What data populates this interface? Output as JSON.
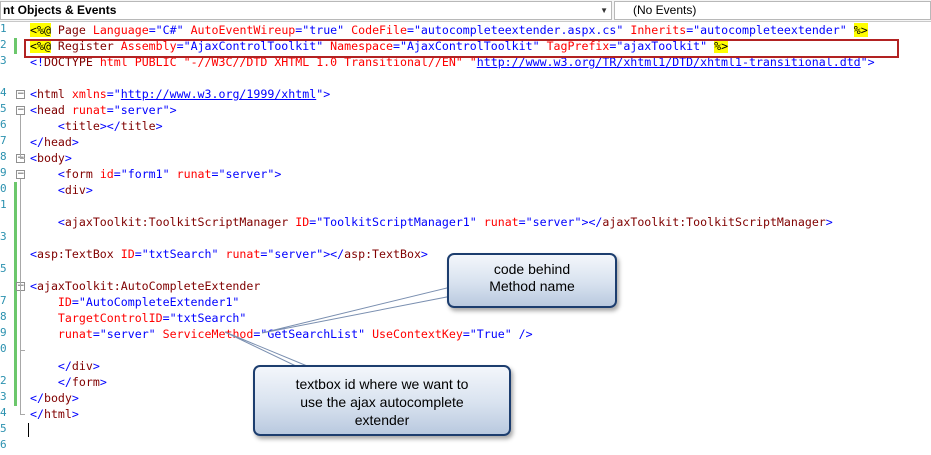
{
  "toolbar": {
    "objects_combo": "nt Objects & Events",
    "events_combo": "(No Events)"
  },
  "line_numbers": [
    "1",
    "2",
    "3",
    "",
    "4",
    "5",
    "6",
    "7",
    "8",
    "9",
    "0",
    "1",
    "",
    "3",
    "",
    "5",
    "",
    "7",
    "8",
    "9",
    "0",
    "",
    "2",
    "3",
    "4",
    "5",
    "6"
  ],
  "code_lines": [
    {
      "tokens": [
        {
          "t": "<%@",
          "c": "t-dir"
        },
        {
          "t": " Page ",
          "c": "t-tag"
        },
        {
          "t": "Language",
          "c": "t-attr"
        },
        {
          "t": "=\"C#\" ",
          "c": "t-val"
        },
        {
          "t": "AutoEventWireup",
          "c": "t-attr"
        },
        {
          "t": "=\"true\" ",
          "c": "t-val"
        },
        {
          "t": "CodeFile",
          "c": "t-attr"
        },
        {
          "t": "=\"autocompleteextender.aspx.cs\" ",
          "c": "t-val"
        },
        {
          "t": "Inherits",
          "c": "t-attr"
        },
        {
          "t": "=\"autocompleteextender\" ",
          "c": "t-val"
        },
        {
          "t": "%>",
          "c": "t-dir"
        }
      ]
    },
    {
      "tokens": [
        {
          "t": "<%@",
          "c": "t-dir"
        },
        {
          "t": " Register ",
          "c": "t-tag"
        },
        {
          "t": "Assembly",
          "c": "t-attr"
        },
        {
          "t": "=\"AjaxControlToolkit\" ",
          "c": "t-val"
        },
        {
          "t": "Namespace",
          "c": "t-attr"
        },
        {
          "t": "=\"AjaxControlToolkit\" ",
          "c": "t-val"
        },
        {
          "t": "TagPrefix",
          "c": "t-attr"
        },
        {
          "t": "=\"ajaxToolkit\" ",
          "c": "t-val"
        },
        {
          "t": "%>",
          "c": "t-dir"
        }
      ]
    },
    {
      "tokens": [
        {
          "t": "<!",
          "c": "t-pun"
        },
        {
          "t": "DOCTYPE",
          "c": "t-tag"
        },
        {
          "t": " html PUBLIC \"-//W3C//DTD XHTML 1.0 Transitional//EN\" \"",
          "c": "t-attr"
        },
        {
          "t": "http://www.w3.org/TR/xhtml1/DTD/xhtml1-transitional.dtd",
          "c": "t-url"
        },
        {
          "t": "\">",
          "c": "t-pun"
        }
      ]
    },
    {
      "tokens": []
    },
    {
      "tokens": [
        {
          "t": "<",
          "c": "t-pun"
        },
        {
          "t": "html",
          "c": "t-tag"
        },
        {
          "t": " ",
          "c": "t-txt"
        },
        {
          "t": "xmlns",
          "c": "t-attr"
        },
        {
          "t": "=\"",
          "c": "t-val"
        },
        {
          "t": "http://www.w3.org/1999/xhtml",
          "c": "t-url"
        },
        {
          "t": "\">",
          "c": "t-pun"
        }
      ]
    },
    {
      "tokens": [
        {
          "t": "<",
          "c": "t-pun"
        },
        {
          "t": "head",
          "c": "t-tag"
        },
        {
          "t": " ",
          "c": "t-txt"
        },
        {
          "t": "runat",
          "c": "t-attr"
        },
        {
          "t": "=\"server\">",
          "c": "t-val"
        }
      ]
    },
    {
      "tokens": [
        {
          "t": "    <",
          "c": "t-pun"
        },
        {
          "t": "title",
          "c": "t-tag"
        },
        {
          "t": "></",
          "c": "t-pun"
        },
        {
          "t": "title",
          "c": "t-tag"
        },
        {
          "t": ">",
          "c": "t-pun"
        }
      ]
    },
    {
      "tokens": [
        {
          "t": "</",
          "c": "t-pun"
        },
        {
          "t": "head",
          "c": "t-tag"
        },
        {
          "t": ">",
          "c": "t-pun"
        }
      ]
    },
    {
      "tokens": [
        {
          "t": "<",
          "c": "t-pun"
        },
        {
          "t": "body",
          "c": "t-tag"
        },
        {
          "t": ">",
          "c": "t-pun"
        }
      ]
    },
    {
      "tokens": [
        {
          "t": "    <",
          "c": "t-pun"
        },
        {
          "t": "form",
          "c": "t-tag"
        },
        {
          "t": " ",
          "c": "t-txt"
        },
        {
          "t": "id",
          "c": "t-attr"
        },
        {
          "t": "=\"form1\" ",
          "c": "t-val"
        },
        {
          "t": "runat",
          "c": "t-attr"
        },
        {
          "t": "=\"server\">",
          "c": "t-val"
        }
      ]
    },
    {
      "tokens": [
        {
          "t": "    <",
          "c": "t-pun"
        },
        {
          "t": "div",
          "c": "t-tag"
        },
        {
          "t": ">",
          "c": "t-pun"
        }
      ]
    },
    {
      "tokens": []
    },
    {
      "tokens": [
        {
          "t": "    <",
          "c": "t-pun"
        },
        {
          "t": "ajaxToolkit:ToolkitScriptManager",
          "c": "t-tag"
        },
        {
          "t": " ",
          "c": "t-txt"
        },
        {
          "t": "ID",
          "c": "t-attr"
        },
        {
          "t": "=\"ToolkitScriptManager1\" ",
          "c": "t-val"
        },
        {
          "t": "runat",
          "c": "t-attr"
        },
        {
          "t": "=\"server\"></",
          "c": "t-val"
        },
        {
          "t": "ajaxToolkit:ToolkitScriptManager",
          "c": "t-tag"
        },
        {
          "t": ">",
          "c": "t-pun"
        }
      ]
    },
    {
      "tokens": []
    },
    {
      "tokens": [
        {
          "t": "<",
          "c": "t-pun"
        },
        {
          "t": "asp:TextBox",
          "c": "t-tag"
        },
        {
          "t": " ",
          "c": "t-txt"
        },
        {
          "t": "ID",
          "c": "t-attr"
        },
        {
          "t": "=\"txtSearch\" ",
          "c": "t-val"
        },
        {
          "t": "runat",
          "c": "t-attr"
        },
        {
          "t": "=\"server\"></",
          "c": "t-val"
        },
        {
          "t": "asp:TextBox",
          "c": "t-tag"
        },
        {
          "t": ">",
          "c": "t-pun"
        }
      ]
    },
    {
      "tokens": []
    },
    {
      "tokens": [
        {
          "t": "<",
          "c": "t-pun"
        },
        {
          "t": "ajaxToolkit:AutoCompleteExtender",
          "c": "t-tag"
        }
      ]
    },
    {
      "tokens": [
        {
          "t": "    ",
          "c": "t-txt"
        },
        {
          "t": "ID",
          "c": "t-attr"
        },
        {
          "t": "=\"AutoCompleteExtender1\"",
          "c": "t-val"
        }
      ]
    },
    {
      "tokens": [
        {
          "t": "    ",
          "c": "t-txt"
        },
        {
          "t": "TargetControlID",
          "c": "t-attr"
        },
        {
          "t": "=\"txtSearch\"",
          "c": "t-val"
        }
      ]
    },
    {
      "tokens": [
        {
          "t": "    ",
          "c": "t-txt"
        },
        {
          "t": "runat",
          "c": "t-attr"
        },
        {
          "t": "=\"server\" ",
          "c": "t-val"
        },
        {
          "t": "ServiceMethod",
          "c": "t-attr"
        },
        {
          "t": "=\"GetSearchList\" ",
          "c": "t-val"
        },
        {
          "t": "UseContextKey",
          "c": "t-attr"
        },
        {
          "t": "=\"True\" />",
          "c": "t-val"
        }
      ]
    },
    {
      "tokens": []
    },
    {
      "tokens": [
        {
          "t": "    </",
          "c": "t-pun"
        },
        {
          "t": "div",
          "c": "t-tag"
        },
        {
          "t": ">",
          "c": "t-pun"
        }
      ]
    },
    {
      "tokens": [
        {
          "t": "    </",
          "c": "t-pun"
        },
        {
          "t": "form",
          "c": "t-tag"
        },
        {
          "t": ">",
          "c": "t-pun"
        }
      ]
    },
    {
      "tokens": [
        {
          "t": "</",
          "c": "t-pun"
        },
        {
          "t": "body",
          "c": "t-tag"
        },
        {
          "t": ">",
          "c": "t-pun"
        }
      ]
    },
    {
      "tokens": [
        {
          "t": "</",
          "c": "t-pun"
        },
        {
          "t": "html",
          "c": "t-tag"
        },
        {
          "t": ">",
          "c": "t-pun"
        }
      ]
    },
    {
      "tokens": []
    }
  ],
  "callouts": {
    "method_note": [
      "code behind",
      "Method name"
    ],
    "textbox_note": [
      "textbox id where we want to",
      "use the ajax autocomplete",
      "extender"
    ]
  },
  "colors": {
    "directive_highlight": "#ffff00",
    "tag": "#800000",
    "attribute": "#ff0000",
    "value": "#0000ff",
    "line_number": "#2b91af",
    "change_bar": "#6cc76c",
    "highlight_box": "#b22222"
  }
}
